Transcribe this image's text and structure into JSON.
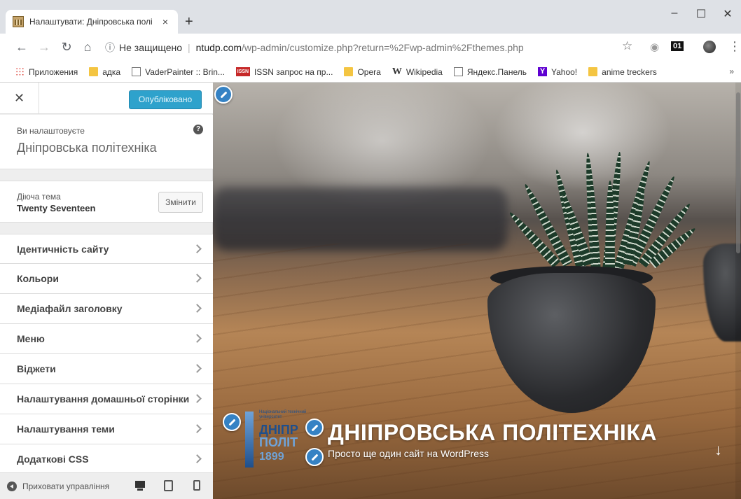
{
  "browser": {
    "tab_title": "Налаштувати: Дніпровська полі",
    "tab_close": "×",
    "new_tab": "+",
    "window_controls": {
      "minimize": "–",
      "maximize": "☐",
      "close": "✕"
    },
    "nav": {
      "back": "←",
      "forward": "→",
      "reload": "↻",
      "home": "⌂"
    },
    "address": {
      "info": "ⓘ",
      "security_label": "Не защищено",
      "host": "ntudp.com",
      "path": "/wp-admin/customize.php?return=%2Fwp-admin%2Fthemes.php"
    },
    "addr_icons": {
      "star": "☆",
      "ext1": "◉",
      "ext2": "01",
      "menu": "⋮"
    },
    "bookmarks": [
      {
        "label": "Приложения",
        "icon": "apps-icon"
      },
      {
        "label": "адка",
        "icon": "folder-icon"
      },
      {
        "label": "VaderPainter :: Brin...",
        "icon": "page-icon"
      },
      {
        "label": "ISSN запрос на пр...",
        "icon": "issn-icon"
      },
      {
        "label": "Opera",
        "icon": "folder-icon"
      },
      {
        "label": "Wikipedia",
        "icon": "wikipedia-icon"
      },
      {
        "label": "Яндекс.Панель",
        "icon": "page-icon"
      },
      {
        "label": "Yahoo!",
        "icon": "yahoo-icon"
      },
      {
        "label": "anime treckers",
        "icon": "folder-icon"
      }
    ],
    "bookmarks_more": "»"
  },
  "sidebar": {
    "close": "✕",
    "publish_label": "Опубліковано",
    "info_small": "Ви налаштовуєте",
    "info_title": "Дніпровська політехніка",
    "help": "?",
    "theme_label": "Діюча тема",
    "theme_name": "Twenty Seventeen",
    "theme_change": "Змінити",
    "menu": [
      {
        "label": "Ідентичність сайту"
      },
      {
        "label": "Кольори"
      },
      {
        "label": "Медіафайл заголовку"
      },
      {
        "label": "Меню"
      },
      {
        "label": "Віджети"
      },
      {
        "label": "Налаштування домашньої сторінки"
      },
      {
        "label": "Налаштування теми"
      },
      {
        "label": "Додаткові CSS"
      }
    ],
    "footer_collapse": "Приховати управління"
  },
  "preview": {
    "site_title": "ДНІПРОВСЬКА ПОЛІТЕХНІКА",
    "tagline": "Просто ще один сайт на WordPress",
    "scroll_arrow": "↓",
    "logo": {
      "small": "Національний технічний університет",
      "line1": "ДНІПР",
      "line2": "ПОЛІТ",
      "year": "1899"
    }
  },
  "colors": {
    "publish_button": "#2ea2cc",
    "edit_shortcut": "#3582c4",
    "logo_dark": "#1f4f8c",
    "logo_light": "#6fa3d8"
  }
}
